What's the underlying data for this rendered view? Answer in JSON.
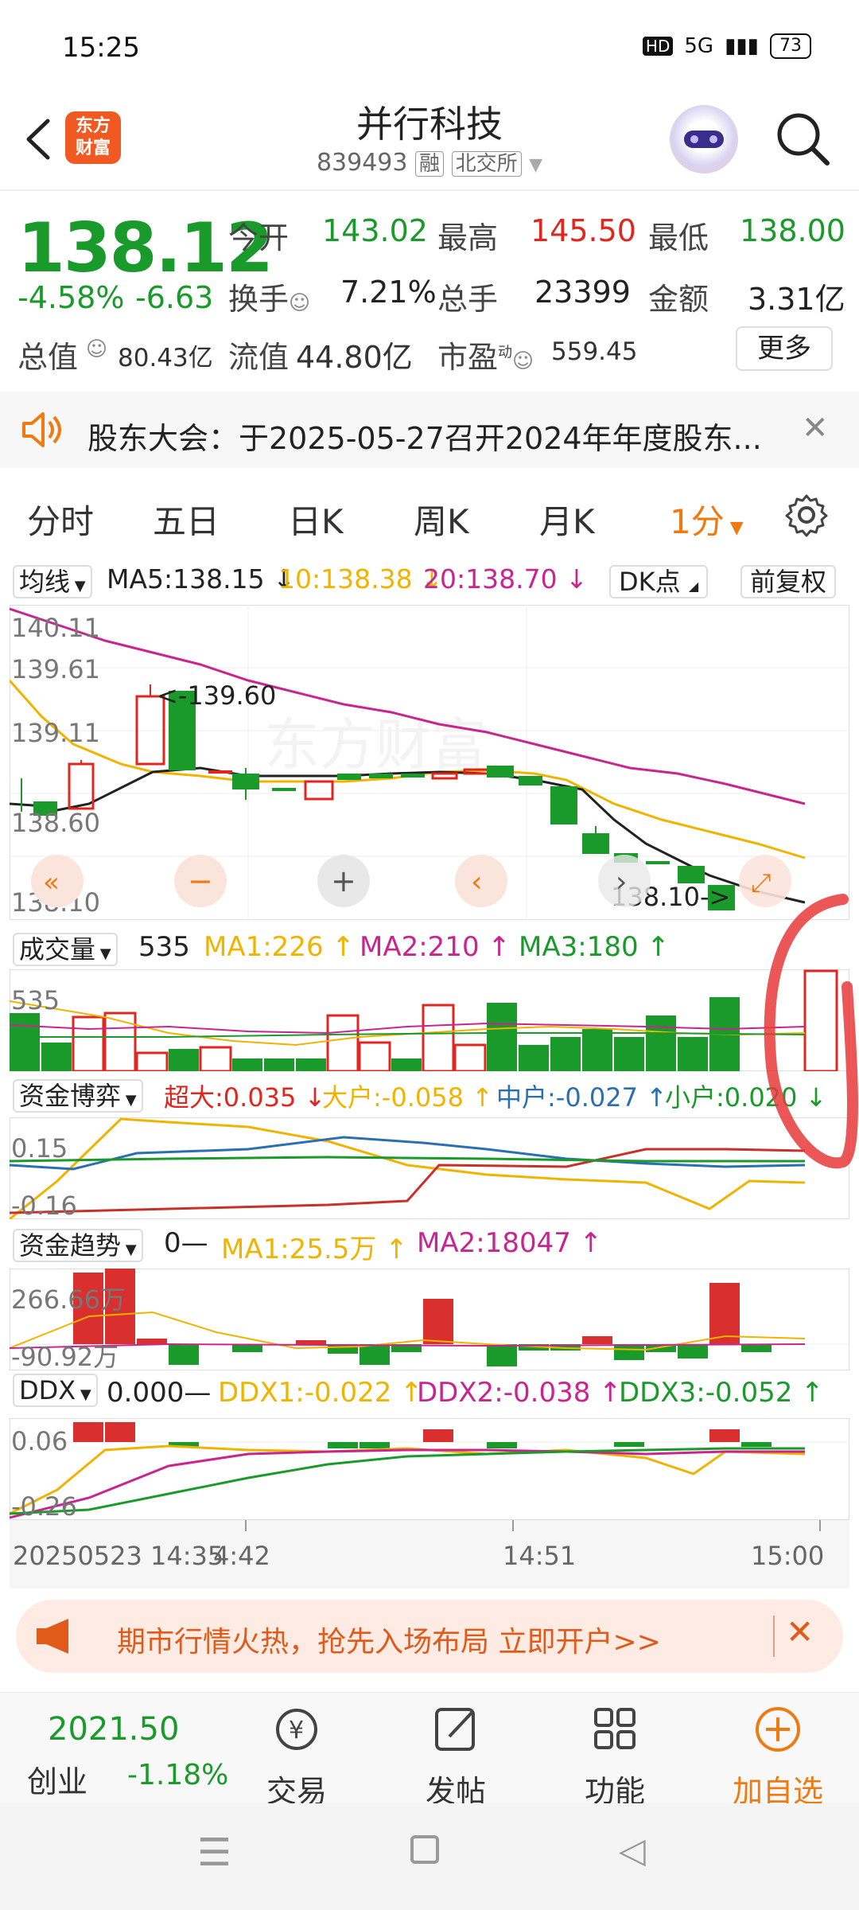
{
  "status_bar": {
    "time": "15:25",
    "network": "5G",
    "battery": "73"
  },
  "header": {
    "logo_text": "东方财富",
    "stock_name": "并行科技",
    "stock_code": "839493",
    "tag_margin": "融",
    "tag_exchange": "北交所"
  },
  "quote": {
    "price": "138.12",
    "change_pct": "-4.58%",
    "change_abs": "-6.63",
    "open_label": "今开",
    "open": "143.02",
    "high_label": "最高",
    "high": "145.50",
    "low_label": "最低",
    "low": "138.00",
    "turnover_label": "换手",
    "turnover": "7.21%",
    "volume_label": "总手",
    "volume": "23399",
    "amount_label": "金额",
    "amount": "3.31亿",
    "total_cap_label": "总值",
    "total_cap": "80.43亿",
    "float_cap_label": "流值",
    "float_cap": "44.80亿",
    "pe_label": "市盈",
    "pe_sup": "动",
    "pe": "559.45",
    "more_label": "更多"
  },
  "notice": {
    "text": "股东大会：于2025-05-27召开2024年年度股东..."
  },
  "tabs": [
    "分时",
    "五日",
    "日K",
    "周K",
    "月K",
    "1分"
  ],
  "kline": {
    "ma_selector": "均线",
    "ma5": "MA5:138.15",
    "ma10": "10:138.38",
    "ma20": "20:138.70",
    "dk_button": "DK点",
    "adjust_button": "前复权",
    "y_labels": [
      "140.11",
      "139.61",
      "139.11",
      "138.60",
      "138.10"
    ],
    "annotation_high": "139.60",
    "annotation_low": "138.10",
    "watermark": "东方财富"
  },
  "volume": {
    "selector": "成交量",
    "value": "535",
    "ma1": "MA1:226",
    "ma2": "MA2:210",
    "ma3": "MA3:180",
    "y_label": "535"
  },
  "fund_game": {
    "selector": "资金博弈",
    "super": "超大:0.035",
    "large": "大户:-0.058",
    "mid": "中户:-0.027",
    "small": "小户:0.020",
    "y_top": "0.15",
    "y_bottom": "-0.16"
  },
  "fund_trend": {
    "selector": "资金趋势",
    "value": "0—",
    "ma1": "MA1:25.5万",
    "ma2": "MA2:18047",
    "y_top": "266.66万",
    "y_bottom": "-90.92万"
  },
  "ddx": {
    "selector": "DDX",
    "value": "0.000—",
    "ddx1": "DDX1:-0.022",
    "ddx2": "DDX2:-0.038",
    "ddx3": "DDX3:-0.052",
    "y_top": "0.06",
    "y_bottom": "-0.26"
  },
  "time_axis": {
    "start": "20250523 14:35",
    "t1": "4:42",
    "t2": "14:51",
    "t3": "15:00"
  },
  "ad": {
    "text": "期市行情火热，抢先入场布局 立即开户>>"
  },
  "bottom_nav": {
    "index_value": "2021.50",
    "index_name": "创业",
    "index_change": "-1.18%",
    "trade": "交易",
    "post": "发帖",
    "functions": "功能",
    "add_watch": "加自选"
  },
  "colors": {
    "up": "#e0261f",
    "down": "#1a9a2a",
    "accent": "#f07a12",
    "ma5": "#222222",
    "ma10": "#f0b400",
    "ma20": "#c8258f"
  }
}
